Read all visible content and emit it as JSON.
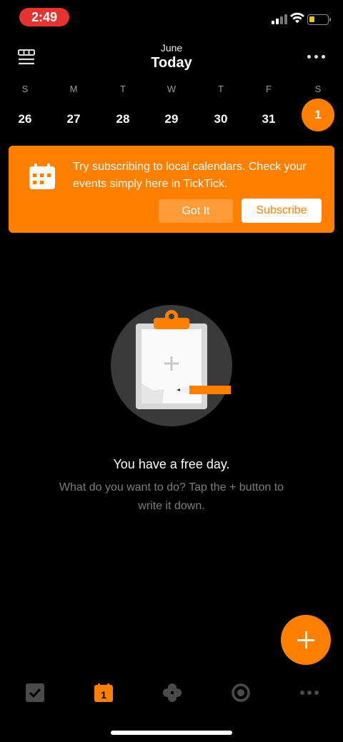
{
  "status": {
    "time": "2:49"
  },
  "header": {
    "month": "June",
    "title": "Today"
  },
  "week": {
    "days": [
      {
        "dow": "S",
        "num": "26"
      },
      {
        "dow": "M",
        "num": "27"
      },
      {
        "dow": "T",
        "num": "28"
      },
      {
        "dow": "W",
        "num": "29"
      },
      {
        "dow": "T",
        "num": "30"
      },
      {
        "dow": "F",
        "num": "31"
      },
      {
        "dow": "S",
        "num": "1"
      }
    ],
    "selected_index": 6
  },
  "banner": {
    "text": "Try subscribing to local calendars. Check your events simply here in TickTick.",
    "got_it_label": "Got It",
    "subscribe_label": "Subscribe"
  },
  "empty_state": {
    "title": "You have a free day.",
    "subtitle": "What do you want to do? Tap the + button to write it down."
  },
  "tabbar": {
    "calendar_badge": "1",
    "items": [
      "task-icon",
      "calendar-icon",
      "matrix-icon",
      "focus-icon",
      "more-icon"
    ]
  },
  "colors": {
    "accent": "#ff8000",
    "background": "#000000",
    "muted_text": "#7c7c7c"
  }
}
